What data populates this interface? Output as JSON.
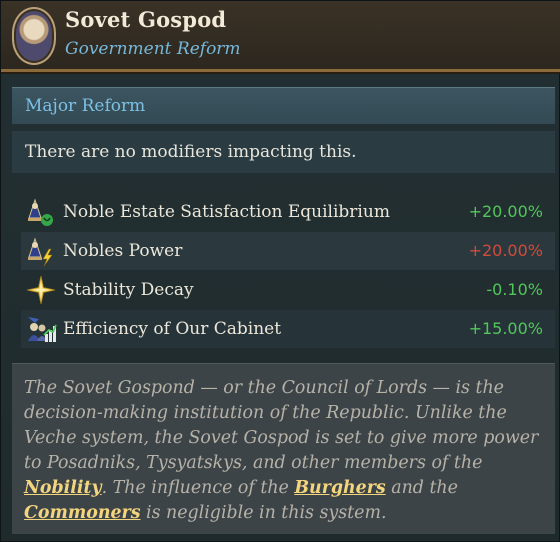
{
  "header": {
    "title": "Sovet Gospod",
    "subtitle": "Government Reform",
    "portrait_icon": "council-portrait-icon"
  },
  "section": {
    "heading": "Major Reform",
    "note": "There are no modifiers impacting this."
  },
  "modifiers": [
    {
      "label": "Noble Estate Satisfaction Equilibrium",
      "value": "+20.00%",
      "color": "#52c65a",
      "icon": "noble-estate-satisfaction-icon"
    },
    {
      "label": "Nobles Power",
      "value": "+20.00%",
      "color": "#d24a3a",
      "icon": "nobles-power-icon"
    },
    {
      "label": "Stability Decay",
      "value": "-0.10%",
      "color": "#52c65a",
      "icon": "stability-star-icon"
    },
    {
      "label": "Efficiency of Our Cabinet",
      "value": "+15.00%",
      "color": "#52c65a",
      "icon": "cabinet-efficiency-icon"
    }
  ],
  "description": {
    "part1": "The Sovet Gospond  — or the Council of Lords — is the decision-making institution of the Republic. Unlike the Veche system, the Sovet Gospod is set to give more power to Posadniks, Tysyatskys, and other members of the ",
    "link1": "Nobility",
    "part2": ". The influence of the ",
    "link2": "Burghers",
    "part3": " and the ",
    "link3": "Commoners",
    "part4": " is negligible in this system."
  }
}
